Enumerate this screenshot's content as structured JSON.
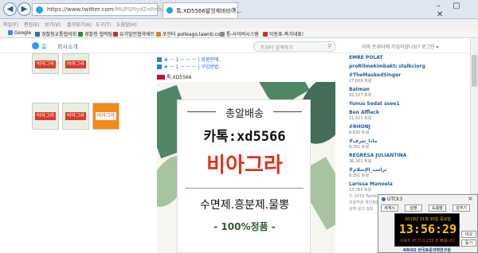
{
  "browser": {
    "url_prefix": "https://",
    "url_main": "www.twitter.com",
    "url_rest": "/MUPSPlydZnRnfs",
    "tab_title": "톡:XD5566발엉제바비아...",
    "tab_close": "×",
    "window_controls": "– ▢ ✕"
  },
  "menubar": [
    "파일(F)",
    "편집(E)",
    "보기(V)",
    "즐겨찾기(A)",
    "도구(T)",
    "도움말(H)"
  ],
  "favorites": [
    {
      "label": "Google",
      "color": "#4285f4"
    },
    {
      "label": "경찰청교통협의회",
      "color": "#2d6bbf"
    },
    {
      "label": "경찰청 협력팀",
      "color": "#3d7f3d"
    },
    {
      "label": "유가발전협약세트",
      "color": "#c0392b"
    },
    {
      "label": "포인터 polleago.lawnb.co...",
      "color": "#e67e22"
    },
    {
      "label": "통-사이버시스템",
      "color": "#7f8c8d"
    },
    {
      "label": "이동표-축가대표!",
      "color": "#c0392b"
    }
  ],
  "twitter_nav": {
    "home": "홈",
    "about": "회사소개",
    "search_placeholder": "트위터 검색하기",
    "signup_text": "이미 트위터에 가입하셨나요? 로그인 ▾"
  },
  "feed": {
    "lines": [
      "# ㅡ 1 ㅡ ㅡ ㅡ | 정품판매..",
      "# ㅡ 1 ㅡ ㅡ ㅡ | 구입방법.."
    ],
    "handle": "톡:XD5566"
  },
  "ad": {
    "line1": "총알배송",
    "line2": "카톡:xd5566",
    "line3": "비아그라",
    "line4": "수면제.흥분제.물뽕",
    "line5": "- 100%정품 -"
  },
  "thumbs": [
    "비아그라",
    "비아그라",
    "비아그라",
    "비아그라",
    "비아그라"
  ],
  "trends": [
    {
      "name": "EMRE POLAT",
      "count": ""
    },
    {
      "name": "proRIlmekimbaktı stalkciorg",
      "count": ""
    },
    {
      "name": "#TheMaskedSinger",
      "count": "27,609 트윗"
    },
    {
      "name": "Batman",
      "count": "92,527 트윗"
    },
    {
      "name": "Yunus Sedat ssee1",
      "count": ""
    },
    {
      "name": "Ben Affleck",
      "count": "21,621 트윗"
    },
    {
      "name": "#RHONJ",
      "count": "8,830 트윗"
    },
    {
      "name": "#ماذا_تعرف",
      "count": "8,351 트윗"
    },
    {
      "name": "REGRESA JULIANTINA",
      "count": "36,301 트윗"
    },
    {
      "name": "#ترامب_الإسلام",
      "count": "8,351 트윗"
    },
    {
      "name": "Larissa Manoela",
      "count": "13,765 트윗"
    }
  ],
  "footer": {
    "line1": "© 2019 Twitter 회사소개",
    "line2": "이용약관 개인정보 보호정책",
    "line3": "상태 광고 정보"
  },
  "clock": {
    "title": "UTCk3",
    "close": "×",
    "buttons": [
      "세계시",
      "설정",
      "도움말",
      "감추기"
    ],
    "date": "2019년 01월 30일 목요일",
    "time": "13:56:29",
    "pc_status": "사용자 PC가 0.233 초 빠릅니다.",
    "side_buttons": [
      "비교",
      "동기"
    ],
    "org": "KRISS 한국표준과학연구원"
  },
  "colors": {
    "twitter_blue": "#1da1f2",
    "ad_red": "#e0321f",
    "lcd_yellow": "#f7c300"
  }
}
